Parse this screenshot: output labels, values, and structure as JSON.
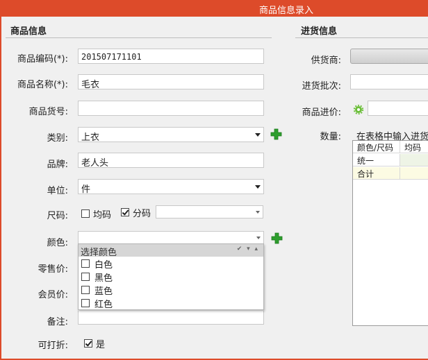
{
  "window": {
    "title": "商品信息录入"
  },
  "left_section": {
    "title": "商品信息"
  },
  "right_section": {
    "title": "进货信息"
  },
  "fields": {
    "code": {
      "label": "商品编码(*):",
      "value": "201507171101"
    },
    "name": {
      "label": "商品名称(*):",
      "value": "毛衣"
    },
    "item_no": {
      "label": "商品货号:",
      "value": ""
    },
    "category": {
      "label": "类别:",
      "value": "上衣"
    },
    "brand": {
      "label": "品牌:",
      "value": "老人头"
    },
    "unit": {
      "label": "单位:",
      "value": "件"
    },
    "size": {
      "label": "尺码:",
      "uniform_label": "均码",
      "uniform_checked": false,
      "split_label": "分码",
      "split_checked": true,
      "split_value": ""
    },
    "color": {
      "label": "颜色:",
      "value": ""
    },
    "retail_price": {
      "label": "零售价:"
    },
    "member_price": {
      "label": "会员价:"
    },
    "remark": {
      "label": "备注:"
    },
    "discountable": {
      "label": "可打折:",
      "option_label": "是",
      "checked": true
    }
  },
  "color_dropdown": {
    "header": "选择颜色",
    "header_tools": "✔ ▾ ▴",
    "options": [
      {
        "label": "白色",
        "checked": false
      },
      {
        "label": "黑色",
        "checked": false
      },
      {
        "label": "蓝色",
        "checked": false
      },
      {
        "label": "红色",
        "checked": false
      }
    ]
  },
  "purchase": {
    "supplier_label": "供货商:",
    "batch_label": "进货批次:",
    "price_label": "商品进价:",
    "qty_label": "数量:",
    "qty_hint": "在表格中输入进货",
    "grid": {
      "headers": [
        "颜色/尺码",
        "均码"
      ],
      "rows": [
        {
          "cells": [
            "统一",
            ""
          ]
        },
        {
          "cells": [
            "合计",
            ""
          ]
        }
      ]
    }
  },
  "colors": {
    "titlebar": "#dd4b2a",
    "add_green": "#2e9e2e",
    "row_highlight": "#fcfbe3"
  }
}
